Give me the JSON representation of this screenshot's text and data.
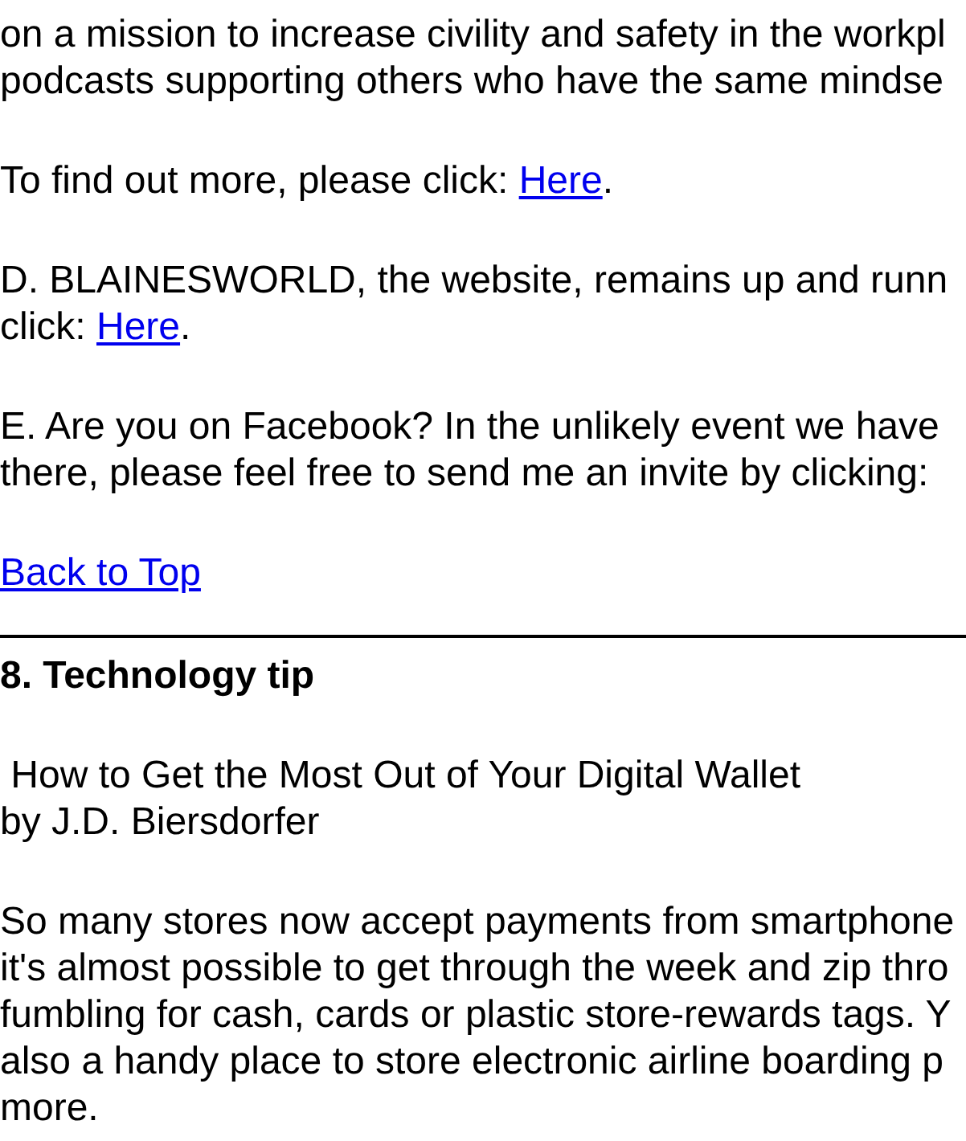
{
  "blocks": [
    {
      "kind": "paragraph",
      "lines": [
        [
          {
            "kind": "text",
            "text": "on a mission to increase civility and safety in the workpl"
          }
        ],
        [
          {
            "kind": "text",
            "text": "podcasts supporting others who have the same mindse"
          }
        ]
      ]
    },
    {
      "kind": "paragraph",
      "lines": [
        [
          {
            "kind": "text",
            "text": "To find out more, please click: "
          },
          {
            "kind": "link",
            "text": "Here"
          },
          {
            "kind": "text",
            "text": "."
          }
        ]
      ]
    },
    {
      "kind": "paragraph",
      "lines": [
        [
          {
            "kind": "text",
            "text": "D. BLAINESWORLD, the website, remains up and runn"
          }
        ],
        [
          {
            "kind": "text",
            "text": "click: "
          },
          {
            "kind": "link",
            "text": "Here"
          },
          {
            "kind": "text",
            "text": "."
          }
        ]
      ]
    },
    {
      "kind": "paragraph",
      "lines": [
        [
          {
            "kind": "text",
            "text": "E. Are you on Facebook? In the unlikely event we have"
          }
        ],
        [
          {
            "kind": "text",
            "text": "there, please feel free to send me an invite by clicking:"
          }
        ]
      ]
    },
    {
      "kind": "paragraph",
      "lines": [
        [
          {
            "kind": "link",
            "text": "Back to Top"
          }
        ]
      ]
    },
    {
      "kind": "rule"
    },
    {
      "kind": "heading",
      "text": "8. Technology tip"
    },
    {
      "kind": "paragraph",
      "lines": [
        [
          {
            "kind": "text",
            "text": " How to Get the Most Out of Your Digital Wallet"
          }
        ],
        [
          {
            "kind": "text",
            "text": "by J.D. Biersdorfer"
          }
        ]
      ]
    },
    {
      "kind": "paragraph",
      "lines": [
        [
          {
            "kind": "text",
            "text": "So many stores now accept payments from smartphone"
          }
        ],
        [
          {
            "kind": "text",
            "text": "it's almost possible to get through the week and zip thro"
          }
        ],
        [
          {
            "kind": "text",
            "text": "fumbling for cash, cards or plastic store-rewards tags. Y"
          }
        ],
        [
          {
            "kind": "text",
            "text": "also a handy place to store electronic airline boarding p"
          }
        ],
        [
          {
            "kind": "text",
            "text": "more."
          }
        ]
      ]
    }
  ]
}
